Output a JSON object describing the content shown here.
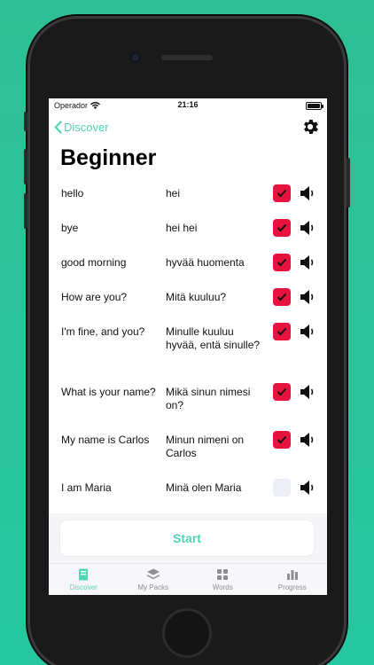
{
  "status": {
    "carrier": "Operador",
    "time": "21:16"
  },
  "nav": {
    "back_label": "Discover"
  },
  "page": {
    "title": "Beginner"
  },
  "phrases": [
    {
      "english": "hello",
      "finnish": "hei",
      "checked": true
    },
    {
      "english": "bye",
      "finnish": "hei hei",
      "checked": true
    },
    {
      "english": "good morning",
      "finnish": "hyvää huomenta",
      "checked": true
    },
    {
      "english": "How are you?",
      "finnish": "Mitä kuuluu?",
      "checked": true
    },
    {
      "english": "I'm fine, and you?",
      "finnish": "Minulle kuuluu hyvää, entä sinulle?",
      "checked": true
    },
    {
      "english": "What is your name?",
      "finnish": "Mikä sinun nimesi on?",
      "checked": true
    },
    {
      "english": "My name is Carlos",
      "finnish": "Minun nimeni on Carlos",
      "checked": true
    },
    {
      "english": "I am Maria",
      "finnish": "Minä olen Maria",
      "checked": false
    }
  ],
  "start_label": "Start",
  "tabs": [
    {
      "label": "Discover",
      "icon": "book-icon",
      "active": true
    },
    {
      "label": "My Packs",
      "icon": "layers-icon",
      "active": false
    },
    {
      "label": "Words",
      "icon": "grid-icon",
      "active": false
    },
    {
      "label": "Progress",
      "icon": "bar-chart-icon",
      "active": false
    }
  ],
  "colors": {
    "accent": "#4fd6b4",
    "check": "#e8123e",
    "background": "#2fbf94"
  }
}
